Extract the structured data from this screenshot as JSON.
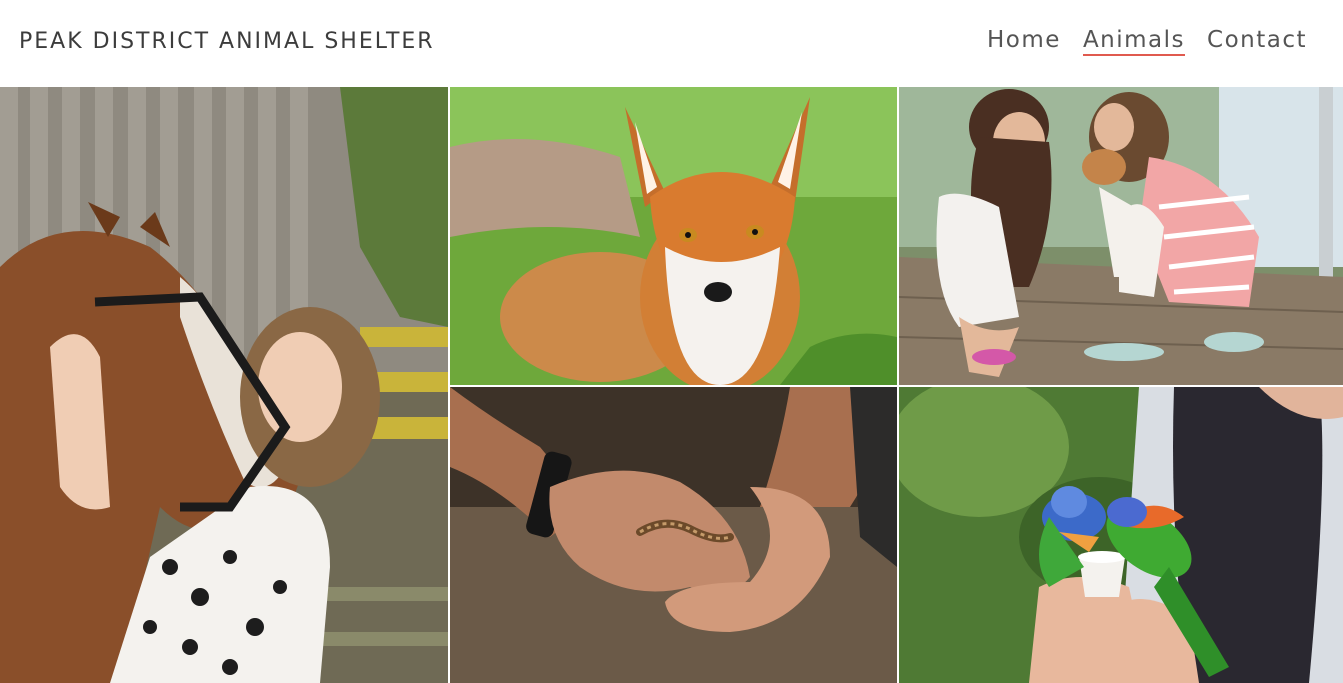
{
  "header": {
    "brand": "PEAK DISTRICT ANIMAL SHELTER",
    "nav": [
      {
        "label": "Home",
        "active": false
      },
      {
        "label": "Animals",
        "active": true
      },
      {
        "label": "Contact",
        "active": false
      }
    ]
  },
  "gallery": {
    "photos": [
      {
        "subject": "girl-hugging-horse"
      },
      {
        "subject": "red-fox-in-grass"
      },
      {
        "subject": "girls-with-puppy"
      },
      {
        "subject": "hands-holding-small-snake"
      },
      {
        "subject": "lorikeets-feeding-from-cup"
      }
    ]
  },
  "colors": {
    "accent_underline": "#e05a4f",
    "brand_text": "#3c3c3c",
    "nav_text": "#555555"
  }
}
